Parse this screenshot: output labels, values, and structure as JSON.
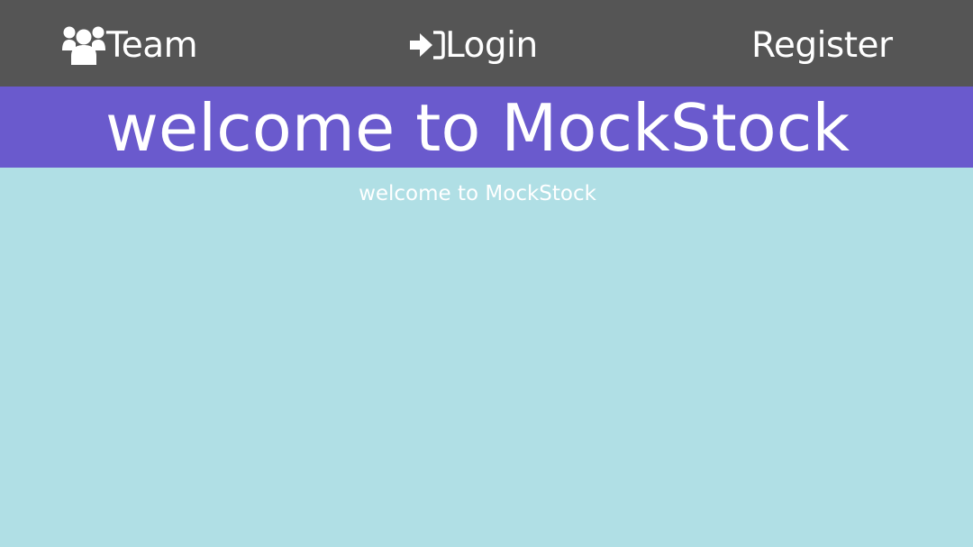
{
  "nav": {
    "team": {
      "label": "Team",
      "icon": "users-icon"
    },
    "login": {
      "label": "Login",
      "icon": "sign-in-icon"
    },
    "register": {
      "label": "Register"
    }
  },
  "banner": {
    "title": "welcome to MockStock"
  },
  "main": {
    "subtitle": "welcome to MockStock"
  },
  "colors": {
    "navbar": "#555555",
    "banner": "#6a5acd",
    "background": "#b0dfe5",
    "text": "#ffffff"
  }
}
